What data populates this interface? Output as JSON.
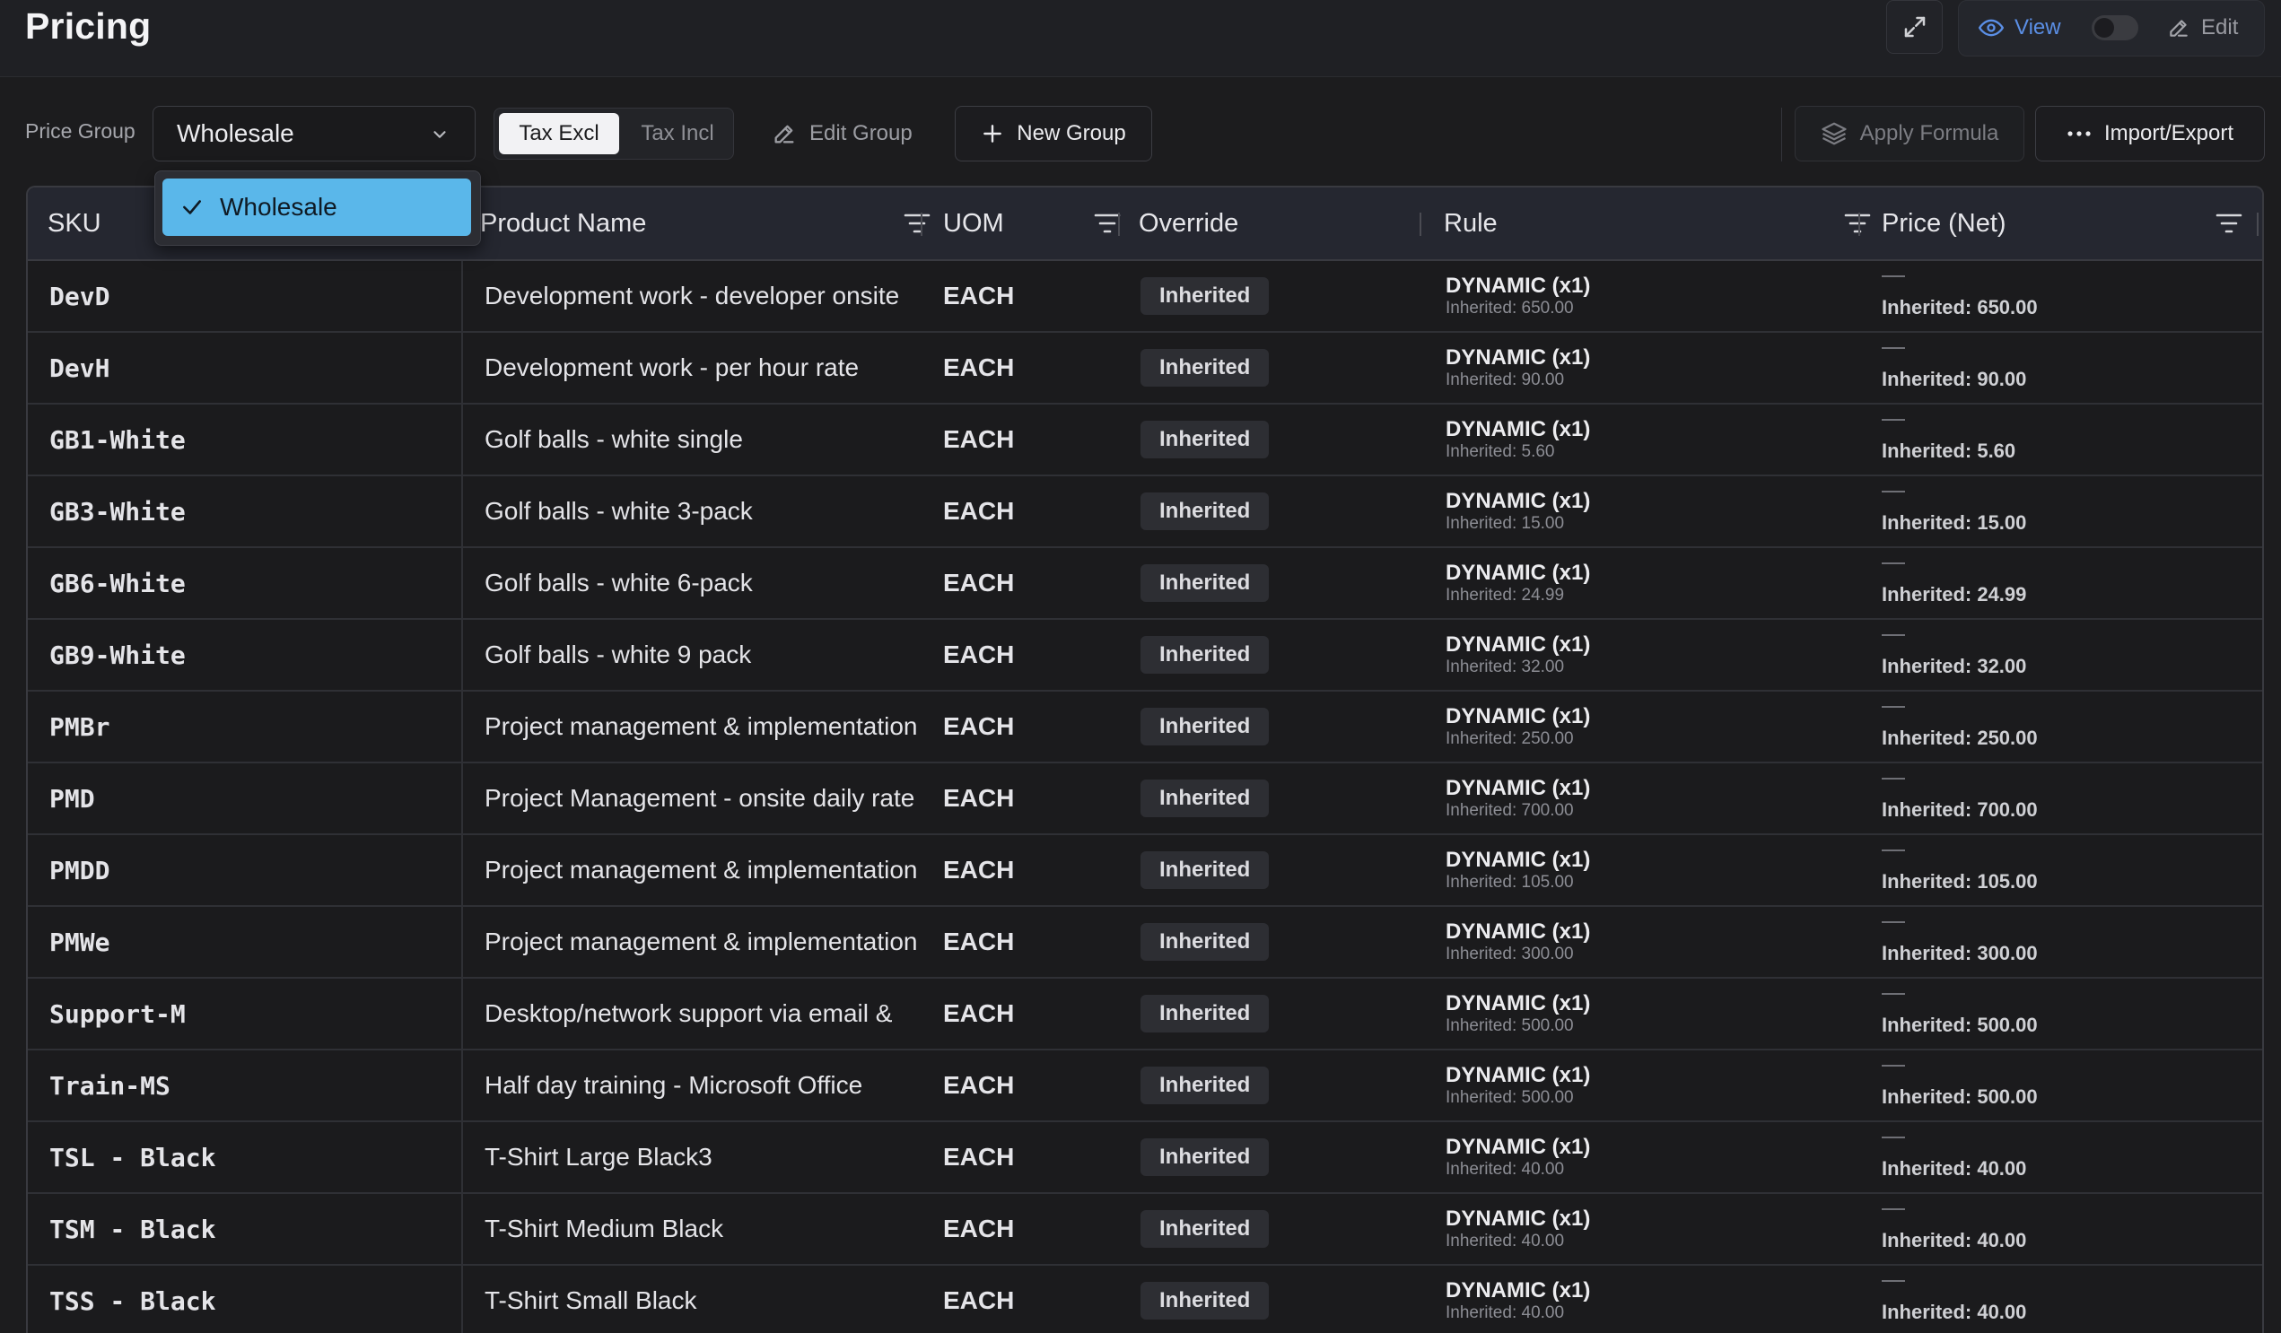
{
  "header": {
    "title": "Pricing",
    "view_label": "View",
    "edit_label": "Edit"
  },
  "toolbar": {
    "price_group_label": "Price Group",
    "price_group_value": "Wholesale",
    "tax_excl": "Tax Excl",
    "tax_incl": "Tax Incl",
    "tax_mode_selected": "Tax Excl",
    "edit_group": "Edit Group",
    "new_group": "New Group",
    "apply_formula": "Apply Formula",
    "import_export": "Import/Export"
  },
  "dropdown": {
    "options": [
      {
        "label": "Wholesale",
        "selected": true
      }
    ]
  },
  "table": {
    "columns": {
      "sku": "SKU",
      "name": "Product Name",
      "uom": "UOM",
      "override": "Override",
      "rule": "Rule",
      "price": "Price (Net)"
    },
    "rows": [
      {
        "sku": "DevD",
        "name": "Development work - developer onsite",
        "uom": "EACH",
        "override": "Inherited",
        "rule": "DYNAMIC (x1)",
        "rule_sub": "Inherited: 650.00",
        "price_dash": "—",
        "price_sub": "Inherited: 650.00"
      },
      {
        "sku": "DevH",
        "name": "Development work - per hour rate",
        "uom": "EACH",
        "override": "Inherited",
        "rule": "DYNAMIC (x1)",
        "rule_sub": "Inherited: 90.00",
        "price_dash": "—",
        "price_sub": "Inherited: 90.00"
      },
      {
        "sku": "GB1-White",
        "name": "Golf balls - white single",
        "uom": "EACH",
        "override": "Inherited",
        "rule": "DYNAMIC (x1)",
        "rule_sub": "Inherited: 5.60",
        "price_dash": "—",
        "price_sub": "Inherited: 5.60"
      },
      {
        "sku": "GB3-White",
        "name": "Golf balls - white 3-pack",
        "uom": "EACH",
        "override": "Inherited",
        "rule": "DYNAMIC (x1)",
        "rule_sub": "Inherited: 15.00",
        "price_dash": "—",
        "price_sub": "Inherited: 15.00"
      },
      {
        "sku": "GB6-White",
        "name": "Golf balls - white 6-pack",
        "uom": "EACH",
        "override": "Inherited",
        "rule": "DYNAMIC (x1)",
        "rule_sub": "Inherited: 24.99",
        "price_dash": "—",
        "price_sub": "Inherited: 24.99"
      },
      {
        "sku": "GB9-White",
        "name": "Golf balls - white 9 pack",
        "uom": "EACH",
        "override": "Inherited",
        "rule": "DYNAMIC (x1)",
        "rule_sub": "Inherited: 32.00",
        "price_dash": "—",
        "price_sub": "Inherited: 32.00"
      },
      {
        "sku": "PMBr",
        "name": "Project management & implementation",
        "uom": "EACH",
        "override": "Inherited",
        "rule": "DYNAMIC (x1)",
        "rule_sub": "Inherited: 250.00",
        "price_dash": "—",
        "price_sub": "Inherited: 250.00"
      },
      {
        "sku": "PMD",
        "name": "Project Management - onsite daily rate",
        "uom": "EACH",
        "override": "Inherited",
        "rule": "DYNAMIC (x1)",
        "rule_sub": "Inherited: 700.00",
        "price_dash": "—",
        "price_sub": "Inherited: 700.00"
      },
      {
        "sku": "PMDD",
        "name": "Project management & implementation",
        "uom": "EACH",
        "override": "Inherited",
        "rule": "DYNAMIC (x1)",
        "rule_sub": "Inherited: 105.00",
        "price_dash": "—",
        "price_sub": "Inherited: 105.00"
      },
      {
        "sku": "PMWe",
        "name": "Project management & implementation",
        "uom": "EACH",
        "override": "Inherited",
        "rule": "DYNAMIC (x1)",
        "rule_sub": "Inherited: 300.00",
        "price_dash": "—",
        "price_sub": "Inherited: 300.00"
      },
      {
        "sku": "Support-M",
        "name": "Desktop/network support via email &",
        "uom": "EACH",
        "override": "Inherited",
        "rule": "DYNAMIC (x1)",
        "rule_sub": "Inherited: 500.00",
        "price_dash": "—",
        "price_sub": "Inherited: 500.00"
      },
      {
        "sku": "Train-MS",
        "name": "Half day training - Microsoft Office",
        "uom": "EACH",
        "override": "Inherited",
        "rule": "DYNAMIC (x1)",
        "rule_sub": "Inherited: 500.00",
        "price_dash": "—",
        "price_sub": "Inherited: 500.00"
      },
      {
        "sku": "TSL - Black",
        "name": "T-Shirt Large Black3",
        "uom": "EACH",
        "override": "Inherited",
        "rule": "DYNAMIC (x1)",
        "rule_sub": "Inherited: 40.00",
        "price_dash": "—",
        "price_sub": "Inherited: 40.00"
      },
      {
        "sku": "TSM - Black",
        "name": "T-Shirt Medium Black",
        "uom": "EACH",
        "override": "Inherited",
        "rule": "DYNAMIC (x1)",
        "rule_sub": "Inherited: 40.00",
        "price_dash": "—",
        "price_sub": "Inherited: 40.00"
      },
      {
        "sku": "TSS - Black",
        "name": "T-Shirt Small Black",
        "uom": "EACH",
        "override": "Inherited",
        "rule": "DYNAMIC (x1)",
        "rule_sub": "Inherited: 40.00",
        "price_dash": "—",
        "price_sub": "Inherited: 40.00"
      }
    ]
  },
  "icons": {
    "expand": "expand-icon",
    "view": "eye-icon",
    "edit": "pencil-icon",
    "select": "chevron-down-icon",
    "edit_group": "pencil-icon",
    "new_group": "plus-icon",
    "apply_formula": "layers-icon",
    "import_export": "more-horizontal-icon",
    "filter": "filter-icon",
    "check": "check-icon"
  },
  "colors": {
    "accent": "#5b8fe6",
    "dropdown_selected": "#5ab7ea",
    "background": "#1c1c1e"
  }
}
